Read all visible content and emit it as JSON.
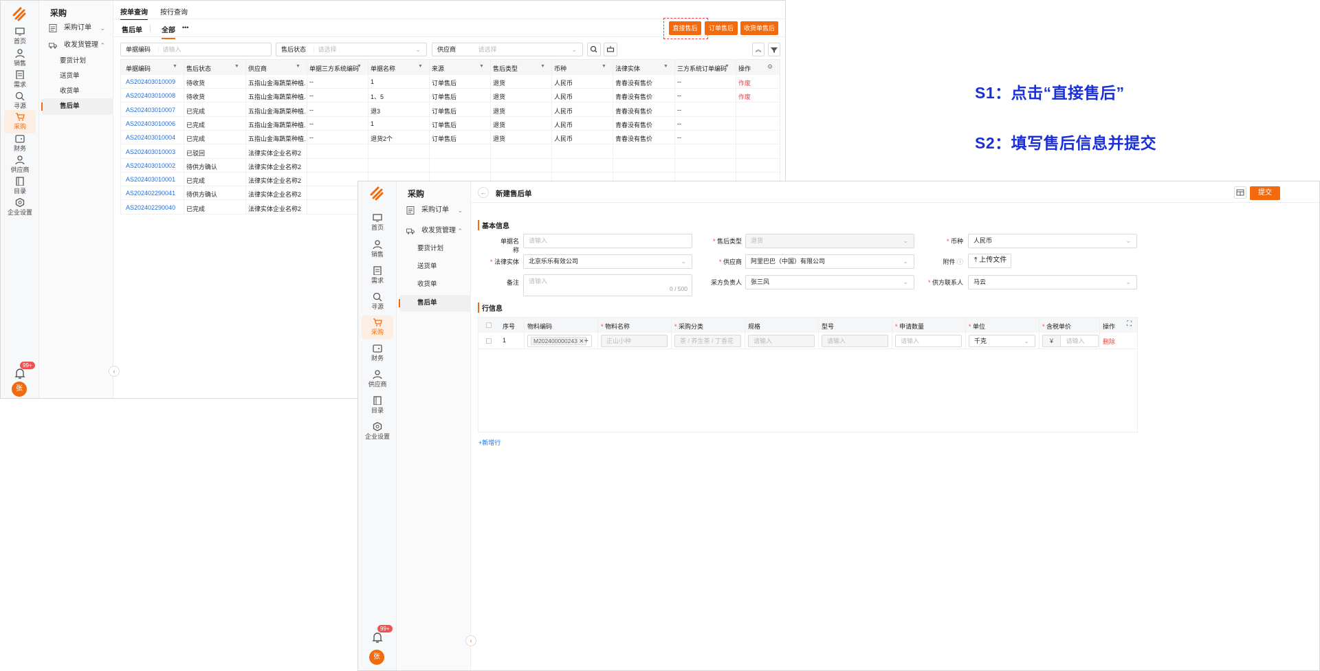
{
  "app": {
    "menu_title": "采购",
    "rail": [
      "首页",
      "销售",
      "需求",
      "寻源",
      "采购",
      "财务",
      "供应商",
      "目录",
      "企业设置"
    ],
    "rail_active_index": 4,
    "badge": "99+",
    "avatar": "张",
    "menu": {
      "purchase_order": "采购订单",
      "receiving": "收发货管理",
      "sub": [
        "要货计划",
        "送货单",
        "收货单",
        "售后单"
      ],
      "active_sub": "售后单"
    },
    "collapse_glyph": "‹"
  },
  "list": {
    "tabs": [
      "按单查询",
      "按行查询"
    ],
    "sub_title": "售后单",
    "filter_tab": "全部",
    "more": "•••",
    "buttons": [
      "直接售后",
      "订单售后",
      "收货单售后"
    ],
    "filters": {
      "code_label": "单据编码",
      "code_placeholder": "请输入",
      "status_label": "售后状态",
      "status_placeholder": "请选择",
      "supplier_label": "供应商",
      "supplier_placeholder": "请选择"
    },
    "columns": [
      "单据编码",
      "售后状态",
      "供应商",
      "单据三方系统编码",
      "单据名称",
      "来源",
      "售后类型",
      "币种",
      "法律实体",
      "三方系统订单编码",
      "操作"
    ],
    "rows": [
      {
        "code": "AS202403010009",
        "status": "待收货",
        "supplier": "五指山金海蔬菜种植...",
        "third": "--",
        "name": "1",
        "source": "订单售后",
        "type": "退货",
        "currency": "人民币",
        "entity": "青春没有售价",
        "order": "--",
        "op": "作废"
      },
      {
        "code": "AS202403010008",
        "status": "待收货",
        "supplier": "五指山金海蔬菜种植...",
        "third": "--",
        "name": "1、5",
        "source": "订单售后",
        "type": "退货",
        "currency": "人民币",
        "entity": "青春没有售价",
        "order": "--",
        "op": "作废"
      },
      {
        "code": "AS202403010007",
        "status": "已完成",
        "supplier": "五指山金海蔬菜种植...",
        "third": "--",
        "name": "退3",
        "source": "订单售后",
        "type": "退货",
        "currency": "人民币",
        "entity": "青春没有售价",
        "order": "--",
        "op": ""
      },
      {
        "code": "AS202403010006",
        "status": "已完成",
        "supplier": "五指山金海蔬菜种植...",
        "third": "--",
        "name": "1",
        "source": "订单售后",
        "type": "退货",
        "currency": "人民币",
        "entity": "青春没有售价",
        "order": "--",
        "op": ""
      },
      {
        "code": "AS202403010004",
        "status": "已完成",
        "supplier": "五指山金海蔬菜种植...",
        "third": "--",
        "name": "退货2个",
        "source": "订单售后",
        "type": "退货",
        "currency": "人民币",
        "entity": "青春没有售价",
        "order": "--",
        "op": ""
      },
      {
        "code": "AS202403010003",
        "status": "已驳回",
        "supplier": "法律实体企业名称2"
      },
      {
        "code": "AS202403010002",
        "status": "待供方确认",
        "supplier": "法律实体企业名称2"
      },
      {
        "code": "AS202403010001",
        "status": "已完成",
        "supplier": "法律实体企业名称2"
      },
      {
        "code": "AS202402290041",
        "status": "待供方确认",
        "supplier": "法律实体企业名称2"
      },
      {
        "code": "AS202402290040",
        "status": "已完成",
        "supplier": "法律实体企业名称2"
      }
    ]
  },
  "form": {
    "back_glyph": "←",
    "title": "新建售后单",
    "submit": "提交",
    "basic_section": "基本信息",
    "fields": {
      "doc_name_label": "单据名称",
      "doc_name_placeholder": "请输入",
      "type_label": "售后类型",
      "type_value": "退货",
      "currency_label": "币种",
      "currency_value": "人民币",
      "entity_label": "法律实体",
      "entity_value": "北京乐乐有效公司",
      "supplier_label": "供应商",
      "supplier_value": "阿里巴巴（中国）有限公司",
      "attach_label": "附件",
      "upload_label": "上传文件",
      "remark_label": "备注",
      "remark_placeholder": "请输入",
      "remark_count": "0 / 500",
      "buyer_label": "采方负责人",
      "buyer_value": "张三风",
      "contact_label": "供方联系人",
      "contact_value": "马云"
    },
    "line_section": "行信息",
    "line_columns": [
      "序号",
      "物料编码",
      "物料名称",
      "采购分类",
      "规格",
      "型号",
      "申请数量",
      "单位",
      "含税单价",
      "操作"
    ],
    "line_row": {
      "index": "1",
      "material_code": "M202400000243",
      "material_name": "正山小种",
      "category": "茶 / 养生茶 / 丁香花",
      "spec_placeholder": "请输入",
      "model_placeholder": "请输入",
      "qty_placeholder": "请输入",
      "unit": "千克",
      "currency_symbol": "¥",
      "price_placeholder": "请输入",
      "op": "删除"
    },
    "add_row": "+新增行"
  },
  "annotations": {
    "s1": "S1：点击“直接售后”",
    "s2": "S2：填写售后信息并提交"
  },
  "colors": {
    "accent": "#f26a0e",
    "link": "#1f6fe0",
    "annotation": "#1a2fd6",
    "danger": "#f04040"
  }
}
